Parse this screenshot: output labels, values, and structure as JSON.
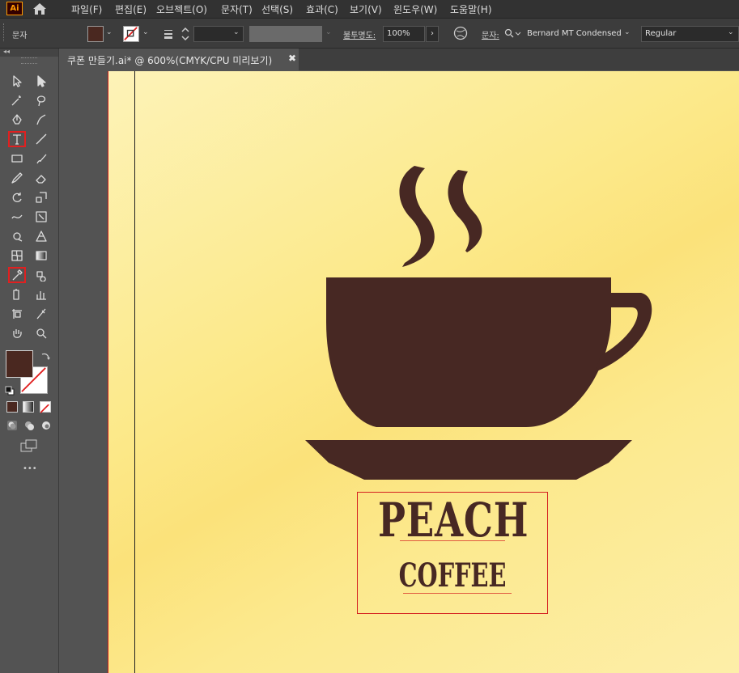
{
  "app": {
    "logo": "Ai"
  },
  "menu": [
    "파일(F)",
    "편집(E)",
    "오브젝트(O)",
    "문자(T)",
    "선택(S)",
    "효과(C)",
    "보기(V)",
    "윈도우(W)",
    "도움말(H)"
  ],
  "control": {
    "mode_label": "문자",
    "opacity_label": "불투명도:",
    "opacity_value": "100%",
    "char_label": "문자:",
    "font_family": "Bernard MT Condensed",
    "font_style": "Regular",
    "fill_color": "#4a2820",
    "icons": [
      "fill-swatch",
      "stroke-none-swatch",
      "stroke-weight-stepper",
      "globe-icon",
      "font-search-icon"
    ]
  },
  "document": {
    "tab_title": "쿠폰 만들기.ai* @ 600%(CMYK/CPU 미리보기)",
    "close_glyph": "✖"
  },
  "toolbar": {
    "collapse_glyph": "◂◂",
    "more_glyph": "•••",
    "selected_tools": [
      "type-tool",
      "eyedropper-tool"
    ],
    "fill_color": "#4a2820"
  },
  "artwork": {
    "title": "PEACH",
    "subtitle": "COFFEE",
    "ink_color": "#472823"
  }
}
